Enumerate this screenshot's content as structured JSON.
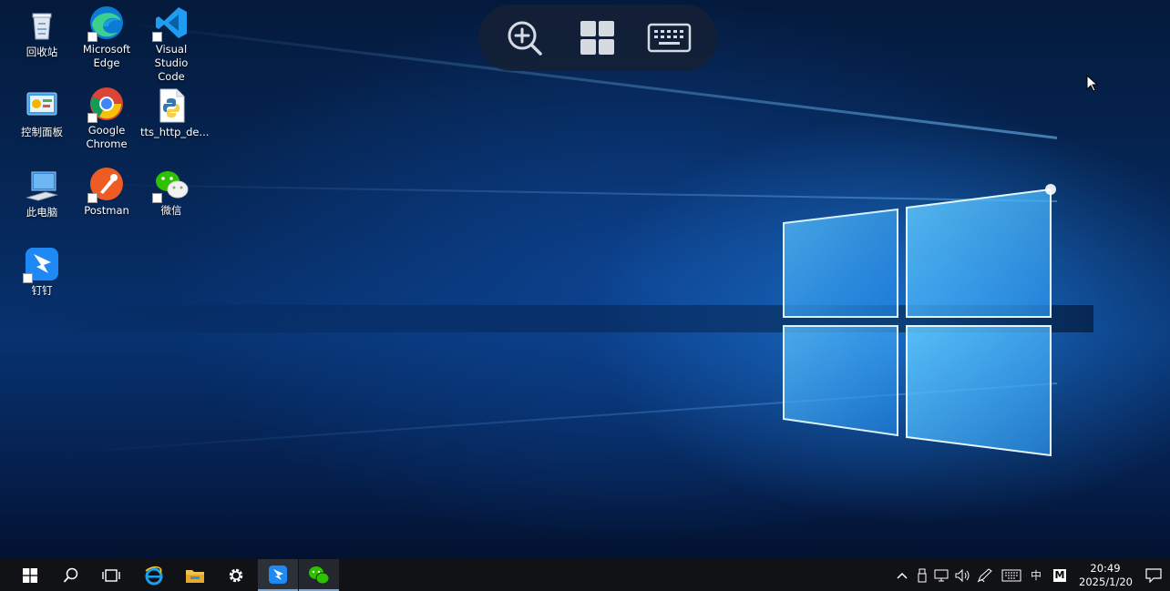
{
  "desktop": {
    "icons": [
      {
        "label": "回收站",
        "icon": "recycle-bin-icon"
      },
      {
        "label": "Microsoft Edge",
        "icon": "edge-icon"
      },
      {
        "label": "Visual Studio Code",
        "icon": "vscode-icon"
      },
      {
        "label": "控制面板",
        "icon": "control-panel-icon"
      },
      {
        "label": "Google Chrome",
        "icon": "chrome-icon"
      },
      {
        "label": "tts_http_de...",
        "icon": "python-file-icon"
      },
      {
        "label": "此电脑",
        "icon": "this-pc-icon"
      },
      {
        "label": "Postman",
        "icon": "postman-icon"
      },
      {
        "label": "微信",
        "icon": "wechat-icon"
      },
      {
        "label": "钉钉",
        "icon": "dingtalk-icon"
      }
    ]
  },
  "remote_toolbar": {
    "buttons": [
      "zoom-in-icon",
      "windows-icon",
      "keyboard-icon"
    ]
  },
  "taskbar": {
    "pinned": [
      "start-icon",
      "search-icon",
      "task-view-icon",
      "internet-explorer-icon",
      "file-explorer-icon",
      "settings-icon",
      "dingtalk-icon",
      "wechat-icon"
    ],
    "tray": {
      "ime_mode": "中",
      "ime_app": "M",
      "time": "20:49",
      "date": "2025/1/20"
    }
  }
}
